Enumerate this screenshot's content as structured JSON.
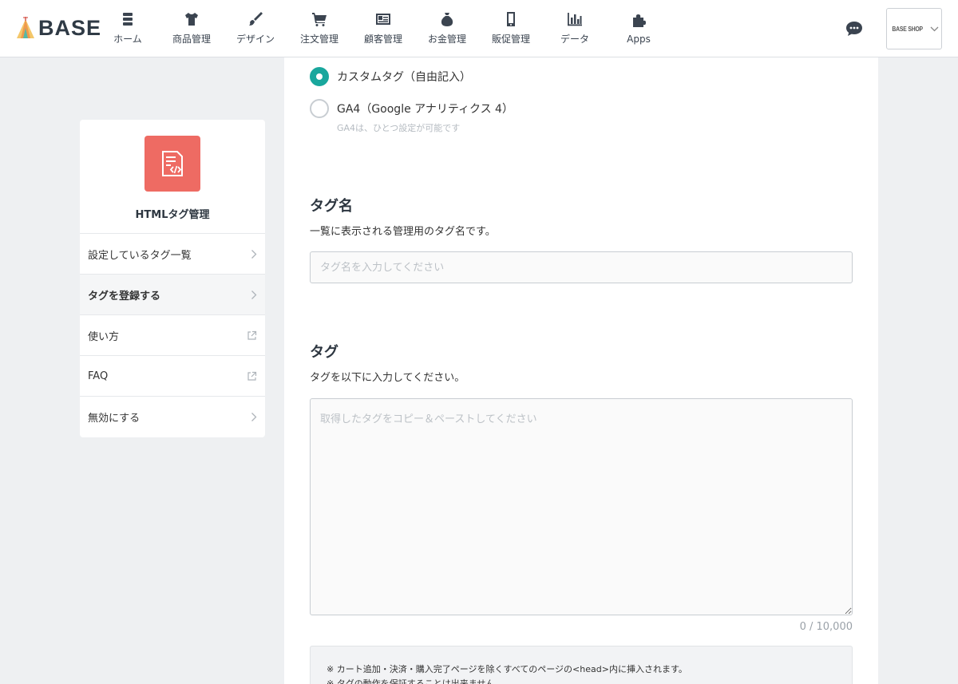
{
  "header": {
    "brand": "BASE",
    "nav": [
      {
        "label": "ホーム",
        "icon": "home-icon"
      },
      {
        "label": "商品管理",
        "icon": "tshirt-icon"
      },
      {
        "label": "デザイン",
        "icon": "brush-icon"
      },
      {
        "label": "注文管理",
        "icon": "cart-icon"
      },
      {
        "label": "顧客管理",
        "icon": "customer-card-icon"
      },
      {
        "label": "お金管理",
        "icon": "money-bag-icon"
      },
      {
        "label": "販促管理",
        "icon": "smartphone-icon"
      },
      {
        "label": "データ",
        "icon": "bar-chart-icon"
      },
      {
        "label": "Apps",
        "icon": "puzzle-icon"
      }
    ],
    "shop_label": "BASE SHOP"
  },
  "sidebar": {
    "app_title": "HTMLタグ管理",
    "app_icon_color": "#ee6b63",
    "items": [
      {
        "label": "設定しているタグ一覧",
        "icon": "chevron-right-icon"
      },
      {
        "label": "タグを登録する",
        "icon": "chevron-right-icon"
      },
      {
        "label": "使い方",
        "icon": "external-link-icon"
      },
      {
        "label": "FAQ",
        "icon": "external-link-icon"
      },
      {
        "label": "無効にする",
        "icon": "chevron-right-icon"
      }
    ]
  },
  "form": {
    "tag_type_options": [
      {
        "label": "カスタムタグ（自由記入）",
        "checked": true
      },
      {
        "label": "GA4（Google アナリティクス 4）",
        "checked": false,
        "note": "GA4は、ひとつ設定が可能です"
      }
    ],
    "tag_name": {
      "title": "タグ名",
      "description": "一覧に表示される管理用のタグ名です。",
      "placeholder": "タグ名を入力してください",
      "value": ""
    },
    "tag": {
      "title": "タグ",
      "description": "タグを以下に入力してください。",
      "placeholder": "取得したタグをコピー＆ペーストしてください",
      "value": "",
      "counter": "0 / 10,000"
    },
    "notes": [
      "※ カート追加・決済・購入完了ページを除くすべてのページの<head>内に挿入されます。",
      "※ タグの動作を保証することは出来ません。"
    ]
  },
  "colors": {
    "accent": "#19a79d",
    "app_icon": "#ee6b63",
    "page_bg": "#eef0f2"
  }
}
